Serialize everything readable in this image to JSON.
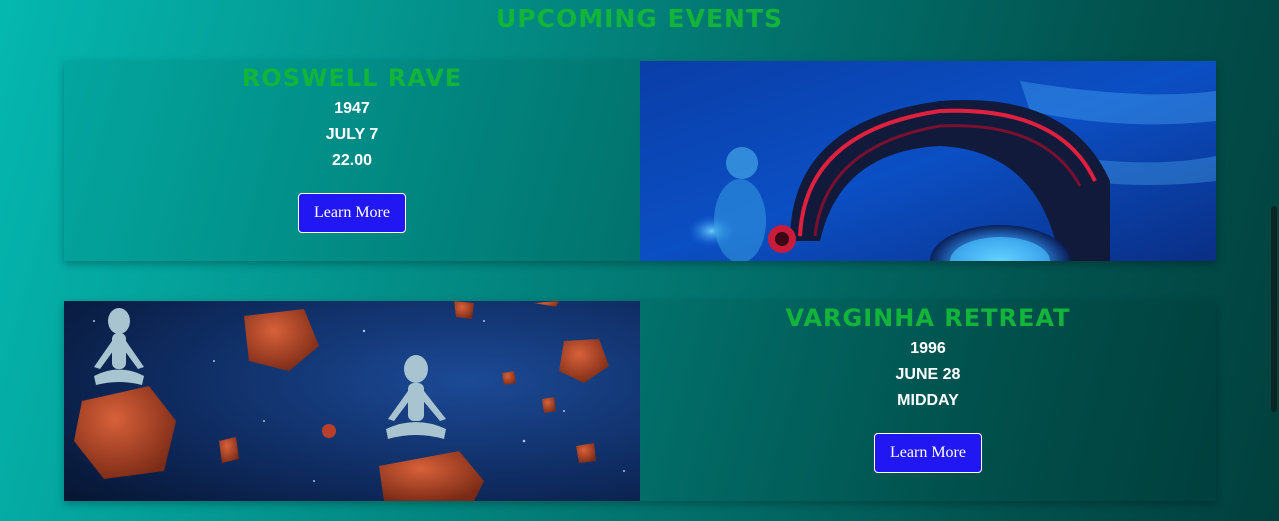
{
  "section": {
    "title": "UPCOMING EVENTS"
  },
  "events": [
    {
      "title": "ROSWELL RAVE",
      "year": "1947",
      "date": "JULY 7",
      "time": "22.00",
      "button": "Learn More",
      "image": "alien-dj-headphones-image"
    },
    {
      "title": "VARGINHA RETREAT",
      "year": "1996",
      "date": "JUNE 28",
      "time": "MIDDAY",
      "button": "Learn More",
      "image": "meditating-aliens-asteroids-image"
    }
  ],
  "colors": {
    "accent_green": "#12b43a",
    "button_blue": "#2117f2",
    "background_teal": "#03807a"
  }
}
